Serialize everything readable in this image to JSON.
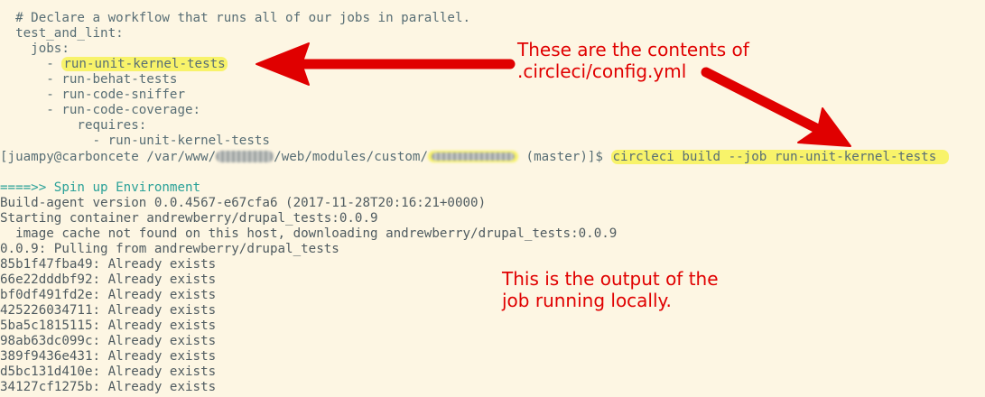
{
  "config_lines": [
    "  # Declare a workflow that runs all of our jobs in parallel.",
    "  test_and_lint:",
    "    jobs:",
    "      - run-unit-kernel-tests",
    "      - run-behat-tests",
    "      - run-code-sniffer",
    "      - run-code-coverage:",
    "          requires:",
    "            - run-unit-kernel-tests"
  ],
  "prompt": {
    "before": "[juampy@carboncete /var/www/",
    "middle": "/web/modules/custom/",
    "after": " (master)]$ ",
    "command": "circleci build --job run-unit-kernel-tests"
  },
  "spin_up_line": "====>> Spin up Environment",
  "output_lines": [
    "Build-agent version 0.0.4567-e67cfa6 (2017-11-28T20:16:21+0000)",
    "Starting container andrewberry/drupal_tests:0.0.9",
    "  image cache not found on this host, downloading andrewberry/drupal_tests:0.0.9",
    "0.0.9: Pulling from andrewberry/drupal_tests",
    "85b1f47fba49: Already exists",
    "66e22dddbf92: Already exists",
    "bf0df491fd2e: Already exists",
    "425226034711: Already exists",
    "5ba5c1815115: Already exists",
    "98ab63dc099c: Already exists",
    "389f9436e431: Already exists",
    "d5bc131d410e: Already exists",
    "34127cf1275b: Already exists"
  ],
  "annotations": {
    "config_note": "These are the contents of\n.circleci/config.yml",
    "output_note": "This is the output of the\njob running locally."
  },
  "colors": {
    "background": "#fdf6e3",
    "text": "#586e75",
    "accent_cyan": "#2aa198",
    "highlight": "#f8f36a",
    "annotation_red": "#e00000"
  }
}
